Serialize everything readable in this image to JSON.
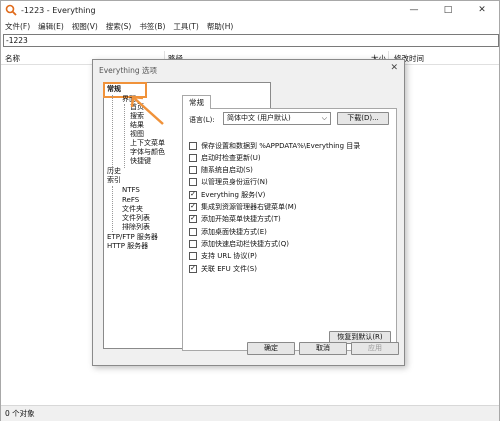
{
  "window": {
    "title": "-1223 - Everything",
    "controls": [
      "—",
      "□",
      "✕"
    ]
  },
  "menu": [
    "文件(F)",
    "编辑(E)",
    "视图(V)",
    "搜索(S)",
    "书签(B)",
    "工具(T)",
    "帮助(H)"
  ],
  "search": {
    "value": "-1223"
  },
  "columns": {
    "name": "名称",
    "path": "路径",
    "size": "大小",
    "modified": "修改时间"
  },
  "status": "0 个对象",
  "dialog": {
    "title": "Everything 选项",
    "close": "✕",
    "tree": {
      "general": "常规",
      "ui": "界面",
      "home": "首页",
      "search": "搜索",
      "results": "结果",
      "view": "视图",
      "context_menu": "上下文菜单",
      "fonts_colors": "字体与颜色",
      "hotkeys": "快捷键",
      "history": "历史",
      "index": "索引",
      "ntfs": "NTFS",
      "refs": "ReFS",
      "folders": "文件夹",
      "file_list": "文件列表",
      "exclude": "排除列表",
      "etp_server": "ETP/FTP 服务器",
      "http_server": "HTTP 服务器"
    },
    "tab_label": "常规",
    "language_label": "语言(L):",
    "language_value": "简体中文 (用户默认)",
    "download_button": "下载(D)...",
    "options": [
      {
        "label": "保存设置和数据到 %APPDATA%\\Everything 目录",
        "checked": false
      },
      {
        "label": "启动时检查更新(U)",
        "checked": false
      },
      {
        "label": "随系统自启动(S)",
        "checked": false
      },
      {
        "label": "以管理员身份运行(N)",
        "checked": false
      },
      {
        "label": "Everything 服务(V)",
        "checked": true
      },
      {
        "label": "集成到资源管理器右键菜单(M)",
        "checked": true
      },
      {
        "label": "添加开始菜单快捷方式(T)",
        "checked": true
      },
      {
        "label": "添加桌面快捷方式(E)",
        "checked": false
      },
      {
        "label": "添加快速启动栏快捷方式(Q)",
        "checked": false
      },
      {
        "label": "支持 URL 协议(P)",
        "checked": false
      },
      {
        "label": "关联 EFU 文件(S)",
        "checked": true
      }
    ],
    "restore_defaults": "恢复到默认(R)",
    "ok": "确定",
    "cancel": "取消",
    "apply": "应用"
  },
  "colors": {
    "highlight": "#f0923a"
  }
}
